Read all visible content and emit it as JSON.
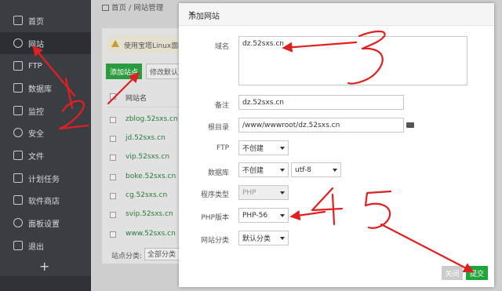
{
  "sidebar": {
    "items": [
      {
        "label": "首页",
        "icon": "home-icon"
      },
      {
        "label": "网站",
        "icon": "globe-icon"
      },
      {
        "label": "FTP",
        "icon": "ftp-icon"
      },
      {
        "label": "数据库",
        "icon": "database-icon"
      },
      {
        "label": "监控",
        "icon": "monitor-icon"
      },
      {
        "label": "安全",
        "icon": "shield-icon"
      },
      {
        "label": "文件",
        "icon": "folder-icon"
      },
      {
        "label": "计划任务",
        "icon": "clock-icon"
      },
      {
        "label": "软件商店",
        "icon": "store-icon"
      },
      {
        "label": "面板设置",
        "icon": "settings-icon"
      },
      {
        "label": "退出",
        "icon": "logout-icon"
      }
    ],
    "active_index": 1,
    "add_label": "+"
  },
  "breadcrumb": {
    "home": "首页",
    "sep": "/",
    "current": "网站管理"
  },
  "background_panel": {
    "warning_text": "使用宝塔Linux面板创",
    "add_site_button": "添加站点",
    "modify_button": "修改默认页",
    "column_header": "网站名",
    "sites": [
      "zblog.52sxs.cn",
      "jd.52sxs.cn",
      "vip.52sxs.cn",
      "boke.52sxs.cn",
      "cg.52sxs.cn",
      "svip.52sxs.cn",
      "www.52sxs.cn"
    ],
    "category_label": "站点分类:",
    "category_value": "全部分类"
  },
  "modal": {
    "title": "添加网站",
    "close": "×",
    "domain_label": "域名",
    "domain_value": "dz.52sxs.cn",
    "remark_label": "备注",
    "remark_value": "dz.52sxs.cn",
    "root_label": "根目录",
    "root_value": "/www/wwwroot/dz.52sxs.cn",
    "ftp_label": "FTP",
    "ftp_value": "不创建",
    "db_label": "数据库",
    "db_value": "不创建",
    "db_charset": "utf-8",
    "program_label": "程序类型",
    "program_value": "PHP",
    "php_label": "PHP版本",
    "php_value": "PHP-56",
    "category_label": "网站分类",
    "category_value": "默认分类",
    "btn_close": "关闭",
    "btn_submit": "提交"
  },
  "annotations": {
    "color": "#e02020",
    "numbers": [
      "1",
      "2",
      "3",
      "4",
      "5"
    ]
  }
}
